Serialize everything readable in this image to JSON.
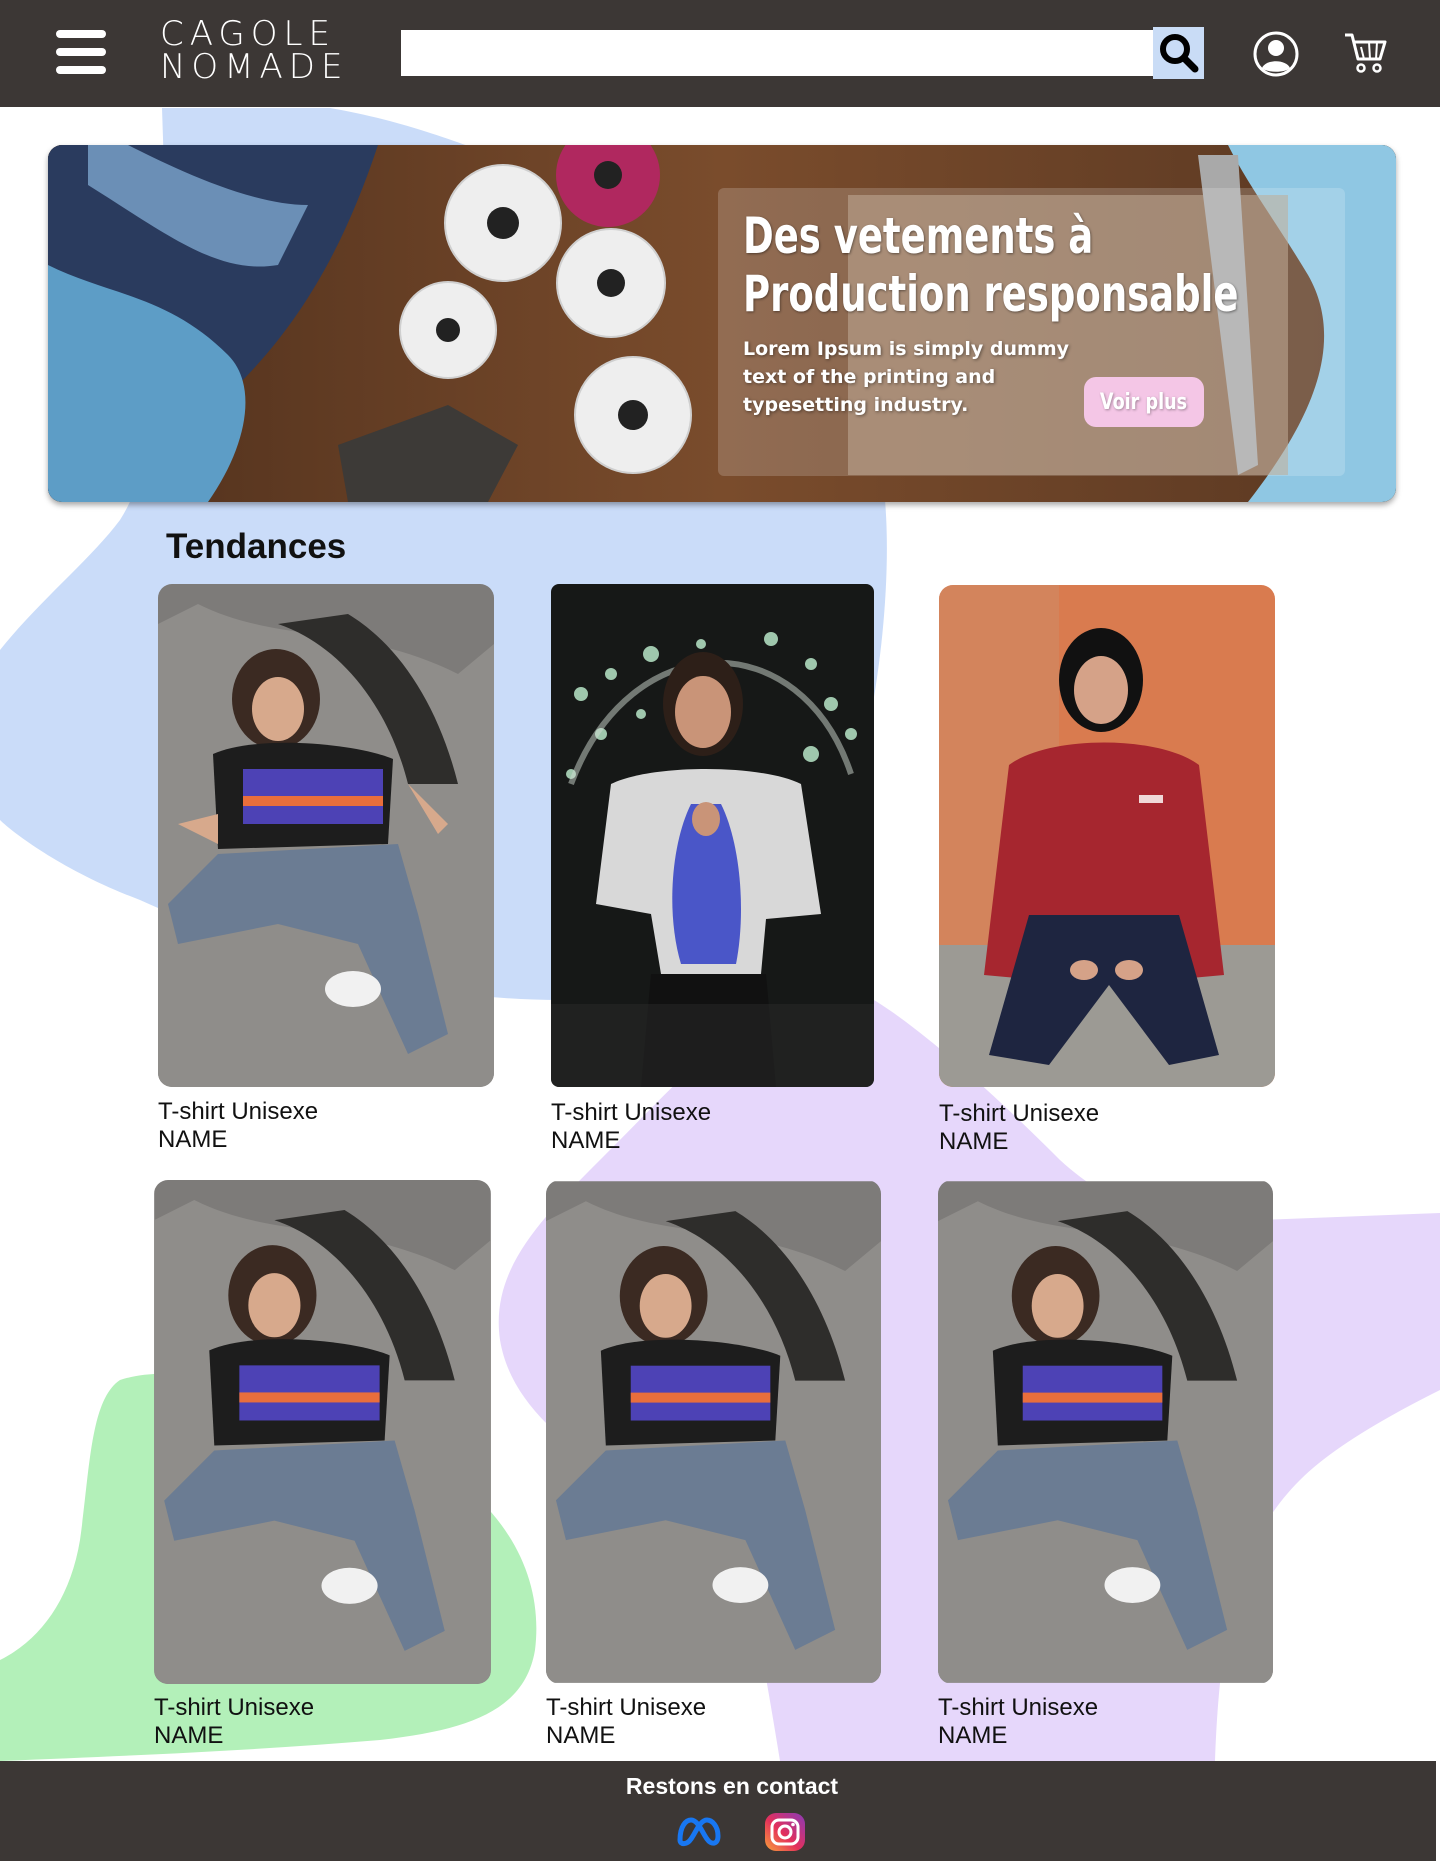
{
  "header": {
    "menu_icon": "hamburger-menu-icon",
    "logo_line1": "CAGOLE",
    "logo_line2": "NOMADE",
    "search": {
      "value": "",
      "placeholder": ""
    },
    "search_icon": "search-icon",
    "account_icon": "user-circle-icon",
    "cart_icon": "shopping-cart-icon"
  },
  "hero": {
    "title_line1": "Des vetements à",
    "title_line2": "Production responsable",
    "text": "Lorem Ipsum is simply dummy text of the printing and typesetting industry.",
    "cta_label": "Voir plus"
  },
  "section": {
    "title": "Tendances"
  },
  "products": [
    {
      "name": "T-shirt Unisexe",
      "subtitle": "NAME"
    },
    {
      "name": "T-shirt Unisexe",
      "subtitle": "NAME"
    },
    {
      "name": "T-shirt Unisexe",
      "subtitle": "NAME"
    },
    {
      "name": "T-shirt Unisexe",
      "subtitle": "NAME"
    },
    {
      "name": "T-shirt Unisexe",
      "subtitle": "NAME"
    },
    {
      "name": "T-shirt Unisexe",
      "subtitle": "NAME"
    }
  ],
  "footer": {
    "title": "Restons en contact",
    "social_icons": [
      "meta-icon",
      "instagram-icon"
    ]
  },
  "colors": {
    "header_bg": "#3c3735",
    "blob_blue": "#cadcf9",
    "blob_purple": "#e6d7fb",
    "blob_green": "#b3f0b9",
    "cta_pink": "#f4c6e6",
    "search_button": "#c9dcf6"
  }
}
